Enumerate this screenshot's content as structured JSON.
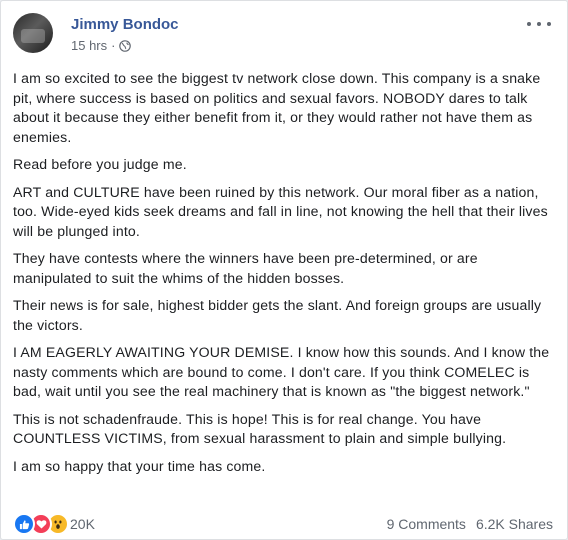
{
  "post": {
    "author": "Jimmy Bondoc",
    "timestamp": "15 hrs",
    "separator": "·",
    "privacy_icon": "globe-icon",
    "paragraphs": [
      "I am so excited to see the biggest tv network close down. This company is a snake pit, where success is based on politics and sexual favors. NOBODY dares to talk about it because they either benefit from it, or they would rather not have them as enemies.",
      "Read before you judge me.",
      "ART and CULTURE have been ruined by this network. Our moral fiber as a nation, too. Wide-eyed kids seek dreams and fall in line, not knowing the hell that their lives will be plunged into.",
      "They have contests where the winners have been pre-determined, or are manipulated to suit the whims of the hidden bosses.",
      "Their news is for sale, highest bidder gets the slant. And foreign groups are usually the victors.",
      "I AM EAGERLY AWAITING YOUR DEMISE. I know how this sounds. And I know the nasty comments which are bound to come. I don't care. If you think COMELEC is bad, wait until you see the real machinery that is known as \"the biggest network.\"",
      "This is not schadenfraude. This is hope! This is for real change. You have COUNTLESS VICTIMS, from sexual harassment to plain and simple bullying.",
      "I am so happy that your time has come."
    ]
  },
  "footer": {
    "reactions_count": "20K",
    "reaction_icons": [
      "like-icon",
      "love-icon",
      "wow-icon"
    ],
    "comments": "9 Comments",
    "shares": "6.2K Shares"
  },
  "colors": {
    "author_link": "#385898",
    "text": "#1c1e21",
    "meta": "#616770",
    "like": "#1877f2",
    "love": "#f33e58",
    "wow": "#f7b928"
  }
}
